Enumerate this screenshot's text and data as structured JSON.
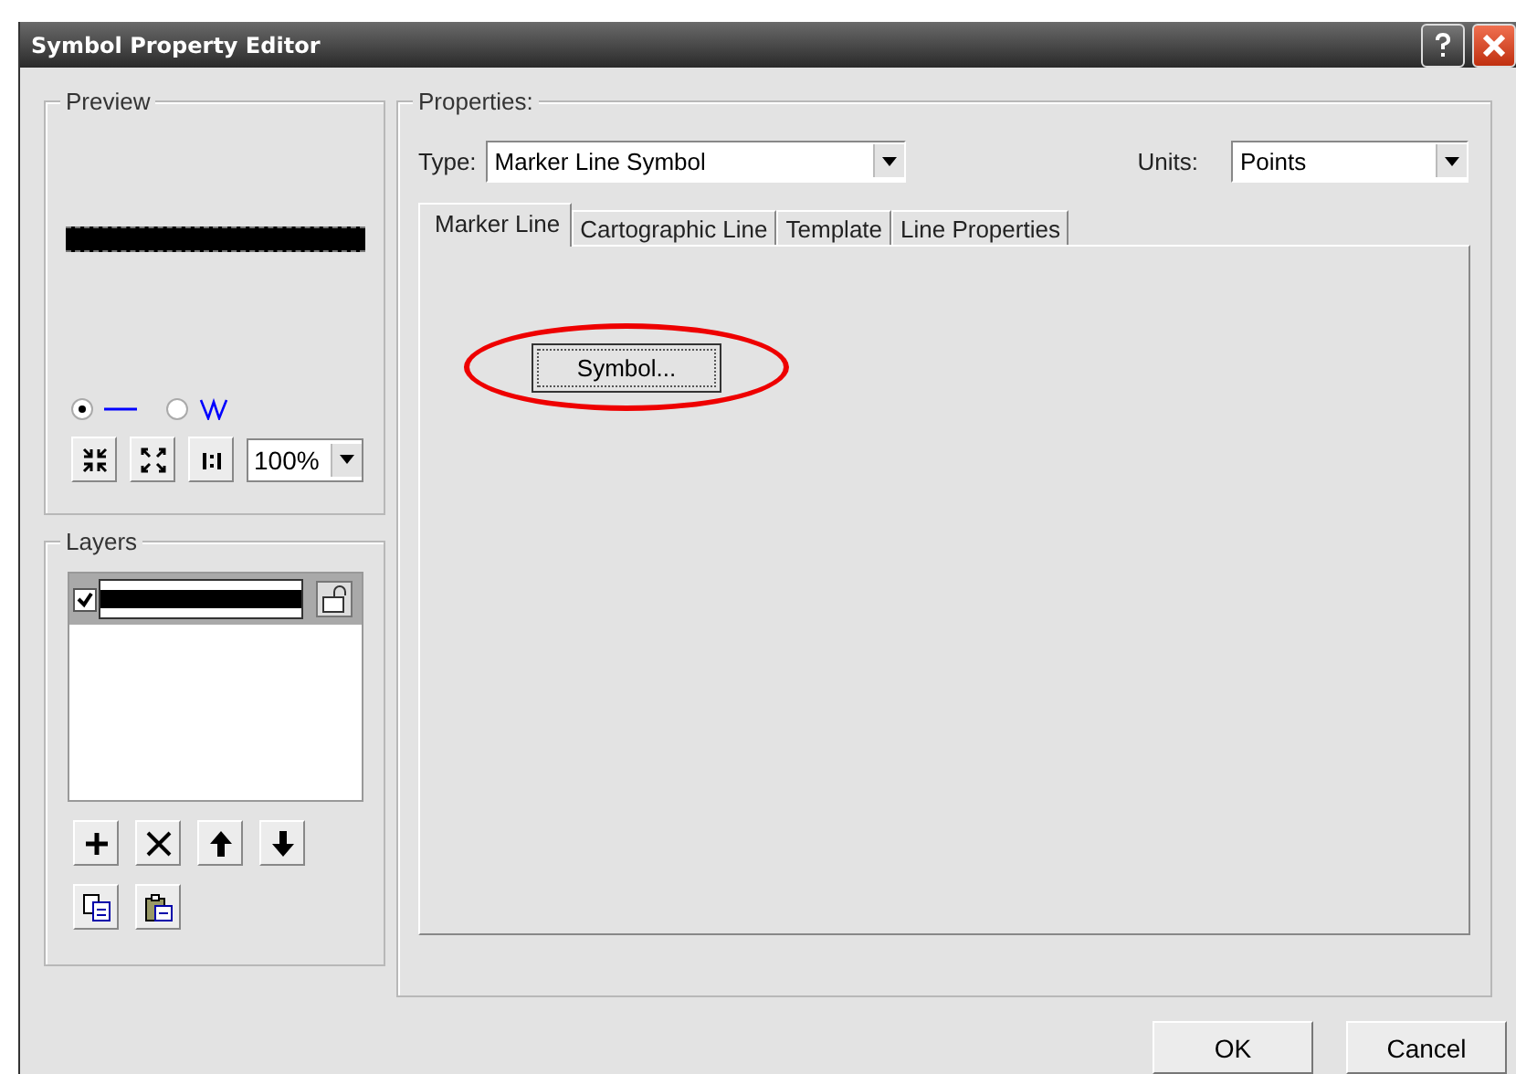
{
  "window": {
    "title": "Symbol Property Editor"
  },
  "preview": {
    "label": "Preview",
    "modes": [
      {
        "kind": "line",
        "selected": true
      },
      {
        "kind": "zigzag",
        "selected": false
      }
    ],
    "zoom": "100%"
  },
  "layers": {
    "label": "Layers",
    "items": [
      {
        "checked": true,
        "selected": true
      }
    ]
  },
  "properties": {
    "label": "Properties:",
    "type_label": "Type:",
    "type_value": "Marker Line Symbol",
    "units_label": "Units:",
    "units_value": "Points",
    "tabs": [
      {
        "label": "Marker Line",
        "selected": true
      },
      {
        "label": "Cartographic Line",
        "selected": false
      },
      {
        "label": "Template",
        "selected": false
      },
      {
        "label": "Line Properties",
        "selected": false
      }
    ],
    "symbol_button": {
      "label": "Symbol...",
      "highlighted": true
    }
  },
  "buttons": [
    "OK",
    "Cancel"
  ]
}
